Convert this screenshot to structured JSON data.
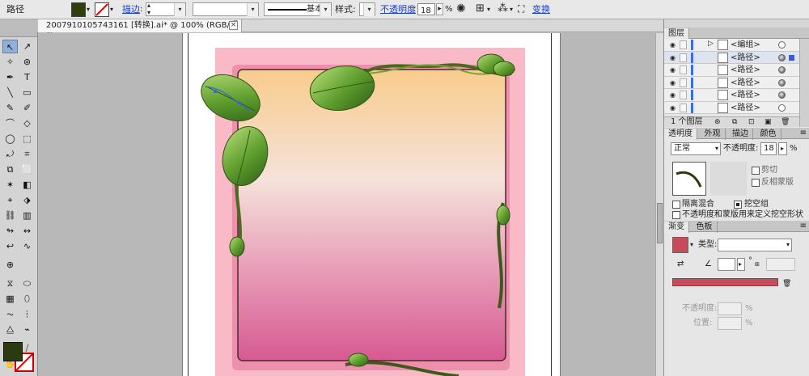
{
  "control_bar": {
    "object_type": "路径",
    "stroke_link": "描边",
    "stroke_profile": "基本",
    "style_label": "样式:",
    "opacity_link": "不透明度",
    "opacity_value": "18",
    "opacity_unit": "%",
    "transform_link": "变换",
    "fill_color": "#2f3f0c"
  },
  "document_tab": {
    "title": "2007910105743161 [转换].ai* @ 100% (RGB/预览)",
    "close_symbol": "×"
  },
  "tools": {
    "fill_color": "#2b3b0f",
    "glyphs": [
      [
        "↖",
        "↗"
      ],
      [
        "✧",
        "⊛"
      ],
      [
        "✒",
        "T"
      ],
      [
        "╲",
        "▭"
      ],
      [
        "✎",
        "✐"
      ],
      [
        "⌒",
        "◇"
      ],
      [
        "◯",
        "⬚"
      ],
      [
        "⤾",
        "⌗"
      ],
      [
        "⧉",
        "⬜"
      ],
      [
        "✶",
        "◧"
      ],
      [
        "⌖",
        "⬗"
      ],
      [
        "⛓",
        "▥"
      ],
      [
        "↬",
        "↭"
      ],
      [
        "↩",
        "∿"
      ],
      [
        "⊕",
        ""
      ],
      [
        "⧖",
        "⬭"
      ],
      [
        "▦",
        "⬯"
      ],
      [
        "⏦",
        "⦙"
      ],
      [
        "⧋",
        "⌁"
      ],
      [
        "□",
        "⧸"
      ],
      [
        "✋",
        "🔍"
      ]
    ]
  },
  "layers_panel": {
    "tab": "图层",
    "rows": [
      {
        "label": "<编组>",
        "target_filled": false,
        "selected": false
      },
      {
        "label": "<路径>",
        "target_filled": true,
        "selected": true
      },
      {
        "label": "<路径>",
        "target_filled": true,
        "selected": false
      },
      {
        "label": "<路径>",
        "target_filled": true,
        "selected": false
      },
      {
        "label": "<路径>",
        "target_filled": true,
        "selected": false
      },
      {
        "label": "<路径>",
        "target_filled": false,
        "selected": false
      }
    ],
    "footer": "1 个图层"
  },
  "transparency_panel": {
    "tabs": [
      "透明度",
      "外观",
      "描边",
      "颜色"
    ],
    "blend_mode": "正常",
    "opacity_label": "不透明度:",
    "opacity_value": "18",
    "opacity_unit": "%",
    "clip_label": "剪切",
    "invert_mask_label": "反相蒙版",
    "isolate_label": "隔离混合",
    "knockout_label": "挖空组",
    "define_knockout_label": "不透明度和蒙版用来定义挖空形状"
  },
  "gradient_panel": {
    "tabs": [
      "渐变",
      "色板"
    ],
    "type_label": "类型:",
    "gradient_color": "#c94b5a",
    "opacity_label": "不透明度:",
    "location_label": "位置:",
    "percent": "%"
  }
}
